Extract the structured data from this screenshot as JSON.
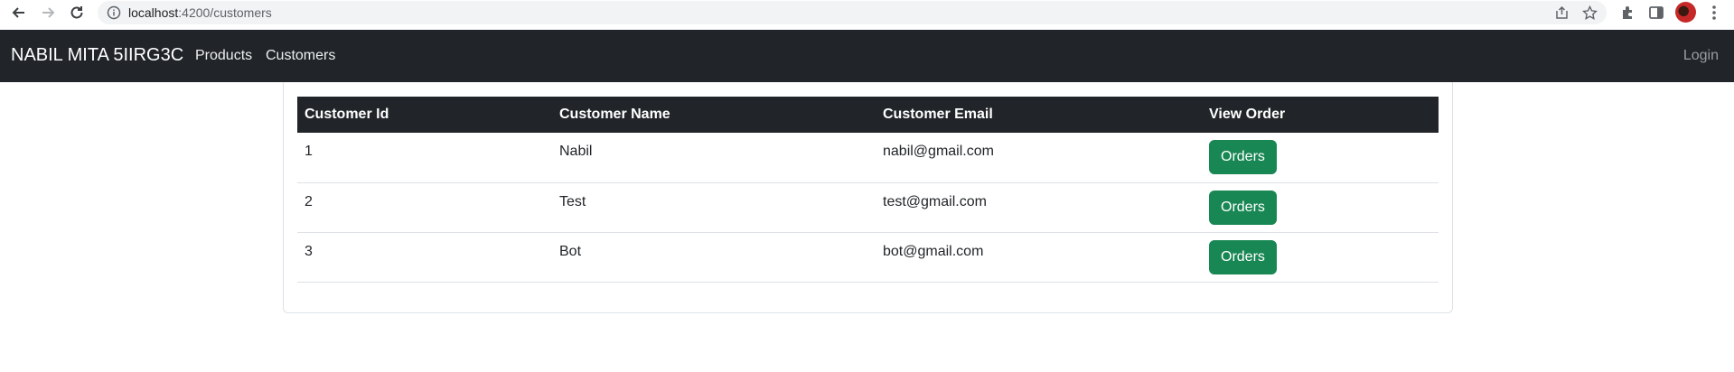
{
  "browser": {
    "url_host": "localhost",
    "url_path": ":4200/customers"
  },
  "navbar": {
    "brand": "NABIL MITA 5IIRG3C",
    "links": [
      "Products",
      "Customers"
    ],
    "login": "Login"
  },
  "table": {
    "headers": [
      "Customer Id",
      "Customer Name",
      "Customer Email",
      "View Order"
    ],
    "rows": [
      {
        "id": "1",
        "name": "Nabil",
        "email": "nabil@gmail.com",
        "action": "Orders"
      },
      {
        "id": "2",
        "name": "Test",
        "email": "test@gmail.com",
        "action": "Orders"
      },
      {
        "id": "3",
        "name": "Bot",
        "email": "bot@gmail.com",
        "action": "Orders"
      }
    ]
  },
  "colors": {
    "navbar_bg": "#212529",
    "button_success": "#198754"
  }
}
